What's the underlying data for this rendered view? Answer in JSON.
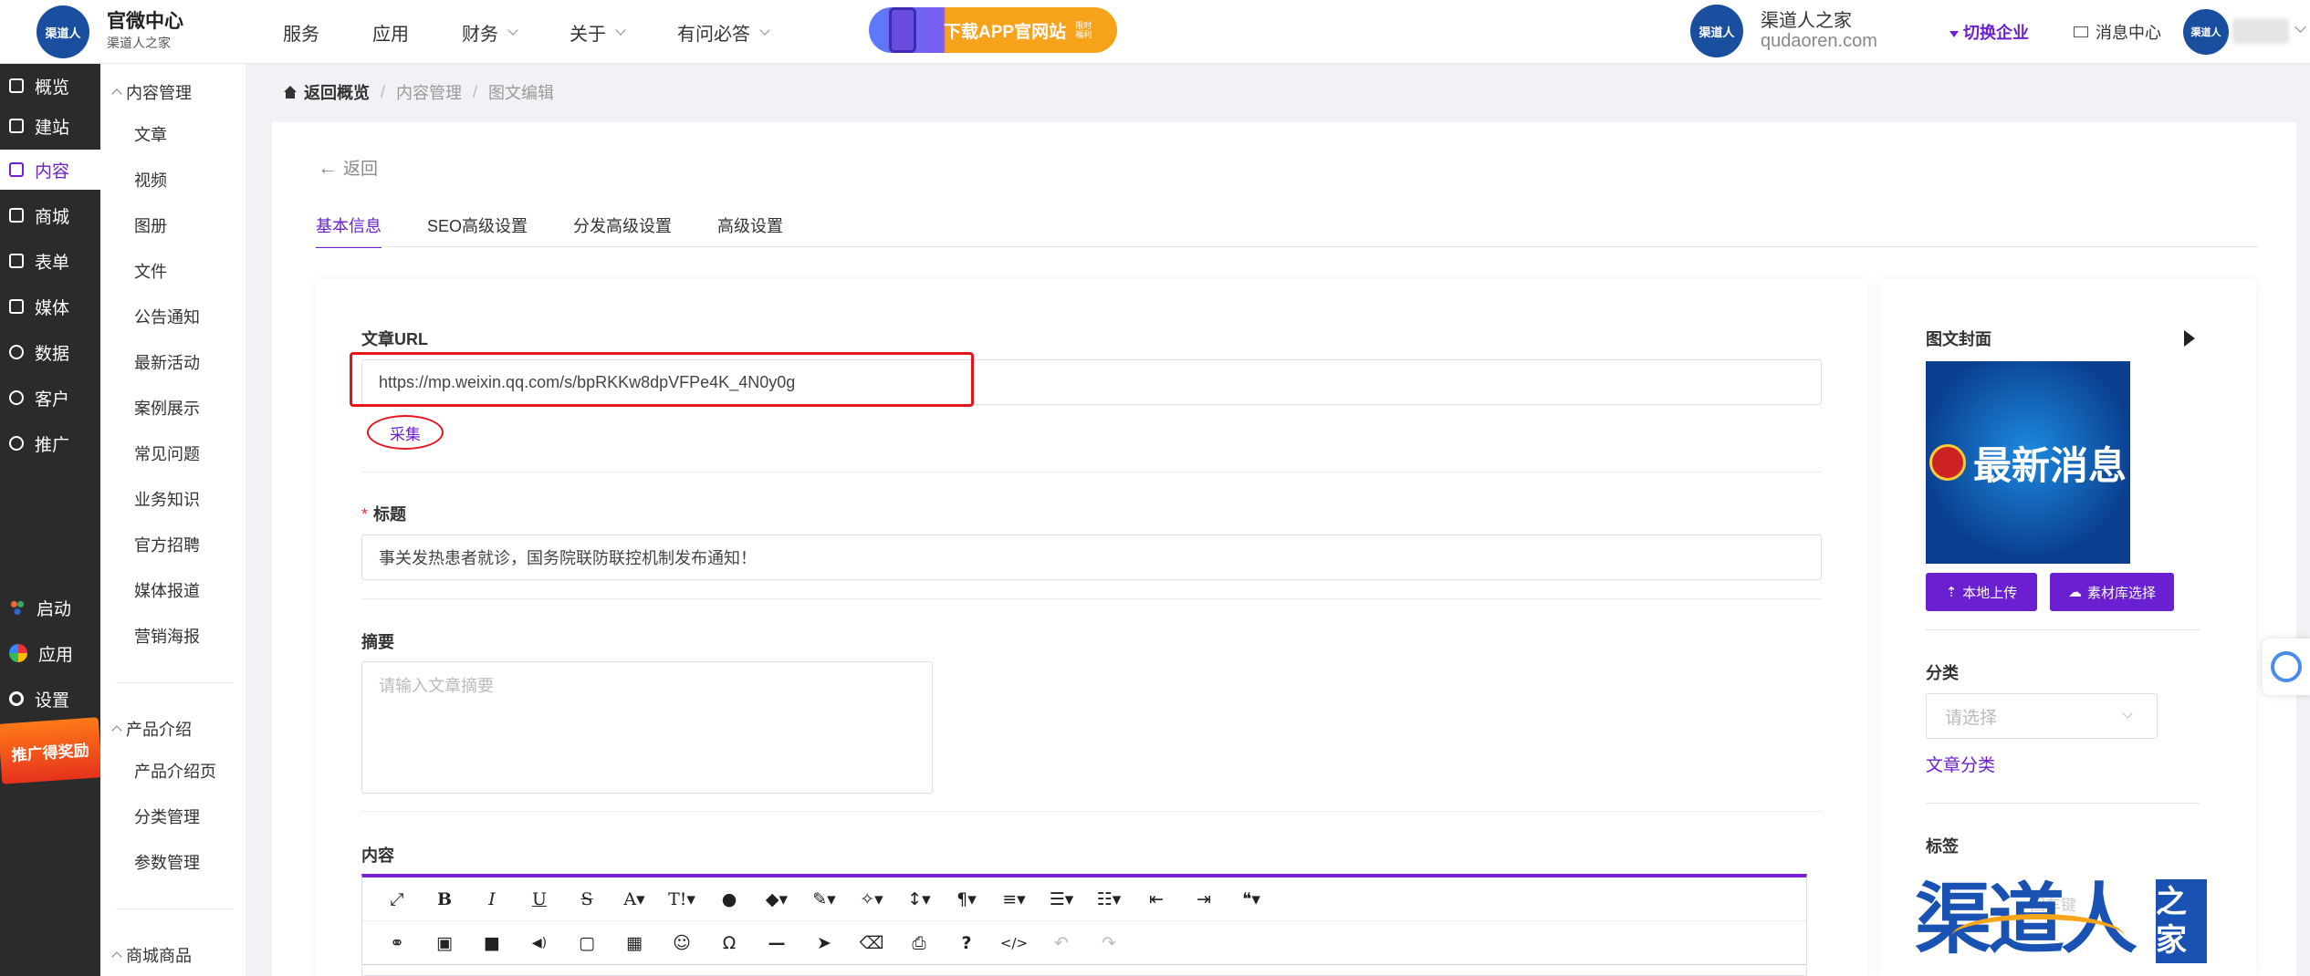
{
  "brand": {
    "logo_text": "渠道人",
    "title": "官微中心",
    "subtitle": "渠道人之家"
  },
  "topnav": [
    {
      "label": "服务",
      "has_dropdown": false
    },
    {
      "label": "应用",
      "has_dropdown": false
    },
    {
      "label": "财务",
      "has_dropdown": true
    },
    {
      "label": "关于",
      "has_dropdown": true
    },
    {
      "label": "有问必答",
      "has_dropdown": true
    }
  ],
  "banner": {
    "text": "下载APP官网站",
    "small": "限时福利"
  },
  "user": {
    "logo_text": "渠道人",
    "name": "渠道人之家",
    "domain": "qudaoren.com",
    "switch_label": "切换企业",
    "messages_label": "消息中心",
    "avatar_text": "渠道人"
  },
  "sidebar": [
    {
      "label": "概览",
      "icon": "cart-icon"
    },
    {
      "label": "建站",
      "icon": "home-icon"
    },
    {
      "label": "内容",
      "icon": "document-icon",
      "active": true
    },
    {
      "label": "商城",
      "icon": "cart-icon"
    },
    {
      "label": "表单",
      "icon": "form-icon"
    },
    {
      "label": "媒体",
      "icon": "video-icon"
    },
    {
      "label": "数据",
      "icon": "chart-icon"
    },
    {
      "label": "客户",
      "icon": "user-icon"
    },
    {
      "label": "推广",
      "icon": "link-icon"
    },
    {
      "label": "启动",
      "icon": "dots-icon"
    },
    {
      "label": "应用",
      "icon": "apps-icon"
    },
    {
      "label": "设置",
      "icon": "gear-icon"
    }
  ],
  "promo": {
    "text": "推广得奖励"
  },
  "subnav": {
    "content_group": "内容管理",
    "content_items": [
      "文章",
      "视频",
      "图册",
      "文件",
      "公告通知",
      "最新活动",
      "案例展示",
      "常见问题",
      "业务知识",
      "官方招聘",
      "媒体报道",
      "营销海报"
    ],
    "product_group": "产品介绍",
    "product_items": [
      "产品介绍页",
      "分类管理",
      "参数管理"
    ],
    "shop_group": "商城商品"
  },
  "breadcrumb": {
    "home": "返回概览",
    "level1": "内容管理",
    "level2": "图文编辑"
  },
  "back_label": "返回",
  "tabs": [
    "基本信息",
    "SEO高级设置",
    "分发高级设置",
    "高级设置"
  ],
  "form": {
    "url_label": "文章URL",
    "url_value": "https://mp.weixin.qq.com/s/bpRKKw8dpVFPe4K_4N0y0g",
    "collect_label": "采集",
    "title_label": "标题",
    "title_value": "事关发热患者就诊，国务院联防联控机制发布通知！",
    "summary_label": "摘要",
    "summary_placeholder": "请输入文章摘要",
    "content_label": "内容"
  },
  "editor_toolbar": {
    "row1": [
      "⤢",
      "B",
      "I",
      "U",
      "S",
      "A▾",
      "T!▾",
      "●",
      "◆▾",
      "✎▾",
      "✧▾",
      "↕▾",
      "¶▾",
      "≡▾",
      "☰▾",
      "☷▾",
      "⇤",
      "⇥",
      "❝▾"
    ],
    "row2": [
      "⚭",
      "▣",
      "■",
      "◀)",
      "▢",
      "▦",
      "☺",
      "Ω",
      "—",
      "➤",
      "⌫",
      "⎙",
      "?",
      "</>",
      "↶",
      "↷"
    ]
  },
  "cover": {
    "label": "图文封面",
    "image_text": "最新消息",
    "upload_label": "本地上传",
    "library_label": "素材库选择"
  },
  "category": {
    "label": "分类",
    "placeholder": "请选择",
    "link": "文章分类"
  },
  "tags": {
    "label": "标签",
    "faint_text": "回车键"
  },
  "watermark": {
    "text": "渠道人",
    "box_text": "之家"
  }
}
